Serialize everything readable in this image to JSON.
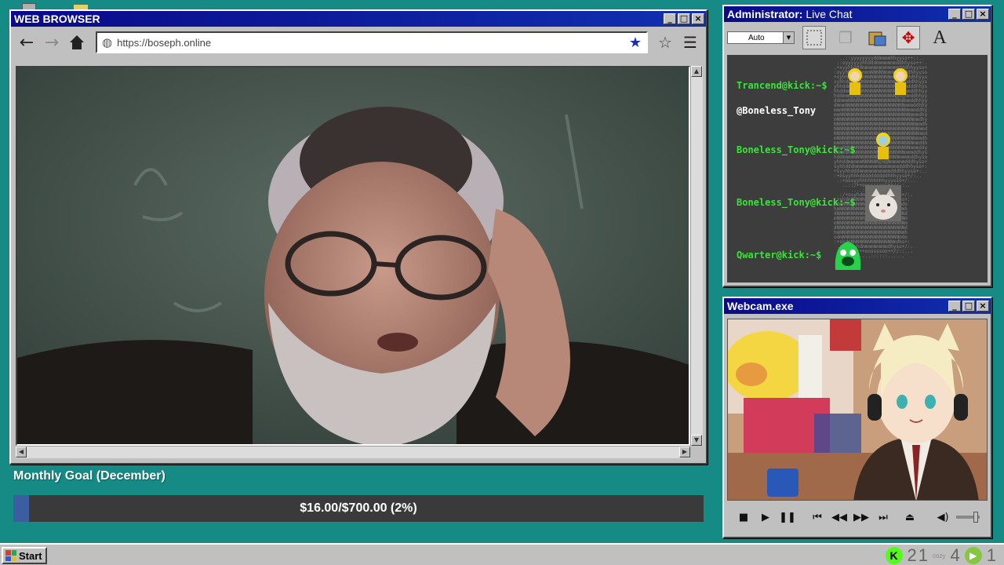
{
  "browser": {
    "title": "WEB BROWSER",
    "url": "https://boseph.online",
    "nav": {
      "back": "back-arrow-icon",
      "forward": "forward-arrow-icon",
      "home": "home-icon"
    }
  },
  "goal": {
    "title": "Monthly Goal (December)",
    "text": "$16.00/$700.00 (2%)",
    "progress": 0.0229
  },
  "chat": {
    "title_prefix": "Administrator:",
    "title_suffix": " Live Chat",
    "select_value": "Auto",
    "messages": [
      {
        "user": "Trancend@kick:~$",
        "emote": "yellow-raincoat-emote"
      },
      {
        "user": "",
        "text": "@Boneless_Tony"
      },
      {
        "user": "Boneless_Tony@kick:~$",
        "emote": "yellow-raincoat-emote"
      },
      {
        "user": "Boneless_Tony@kick:~$",
        "emote": "cat-emote"
      },
      {
        "user": "Qwarter@kick:~$",
        "emote": "green-blob-emote"
      }
    ]
  },
  "webcam": {
    "title": "Webcam.exe"
  },
  "taskbar": {
    "start_label": "Start",
    "kick_count": "2",
    "kick_second": "1",
    "cozy_label": "cozy",
    "cozy_count": "4",
    "rumble_count": "1"
  },
  "colors": {
    "desktop": "#168a84",
    "titlebar": "#0a0a8a",
    "chat_user": "#37e637",
    "goal_fill": "#3b5ea0"
  }
}
